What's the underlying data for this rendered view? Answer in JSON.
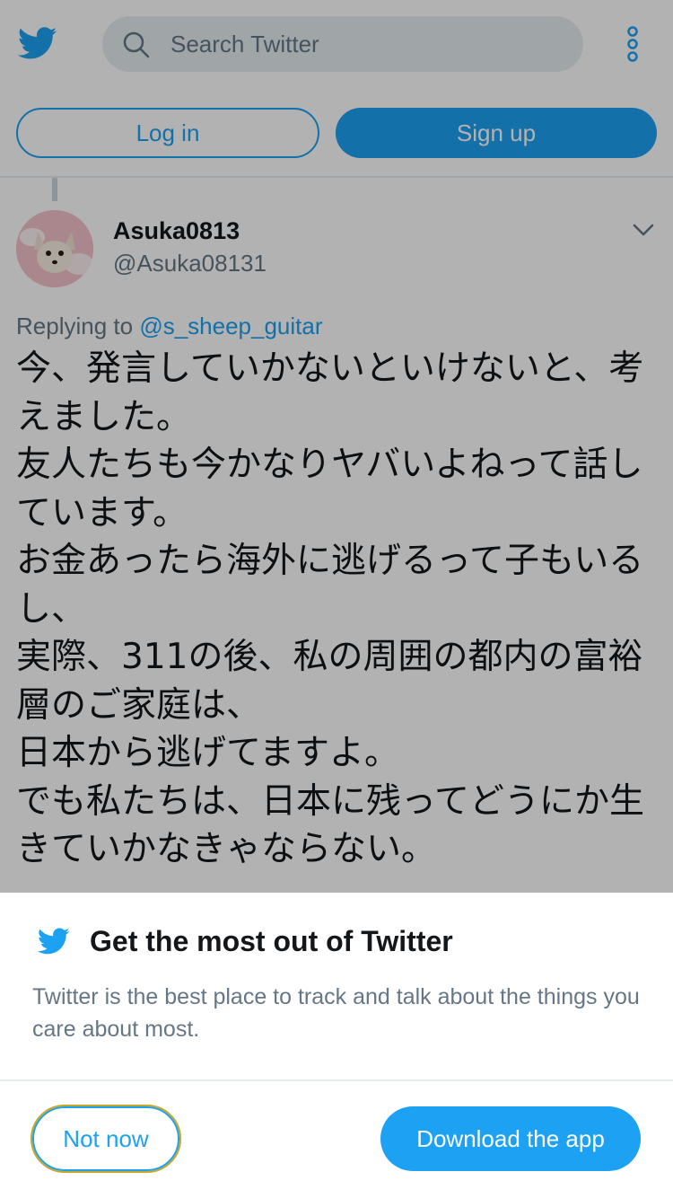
{
  "header": {
    "logo_icon": "twitter-bird-icon",
    "search": {
      "placeholder": "Search Twitter",
      "icon": "search-icon"
    },
    "menu_icon": "more-vertical-icon",
    "login_label": "Log in",
    "signup_label": "Sign up"
  },
  "tweet": {
    "display_name": "Asuka0813",
    "handle": "@Asuka08131",
    "replying_prefix": "Replying to",
    "replying_to": "@s_sheep_guitar",
    "text": "今、発言していかないといけないと、考えました。\n友人たちも今かなりヤバいよねって話しています。\nお金あったら海外に逃げるって子もいるし、\n実際、311の後、私の周囲の都内の富裕層のご家庭は、\n日本から逃げてますよ。\nでも私たちは、日本に残ってどうにか生きていかなきゃならない。"
  },
  "prompt": {
    "title": "Get the most out of Twitter",
    "description": "Twitter is the best place to track and talk about the things you care about most.",
    "not_now_label": "Not now",
    "download_label": "Download the app"
  },
  "colors": {
    "brand": "#1da1f2",
    "secondary_text": "#657786",
    "focus_outline": "#c8a62a"
  }
}
